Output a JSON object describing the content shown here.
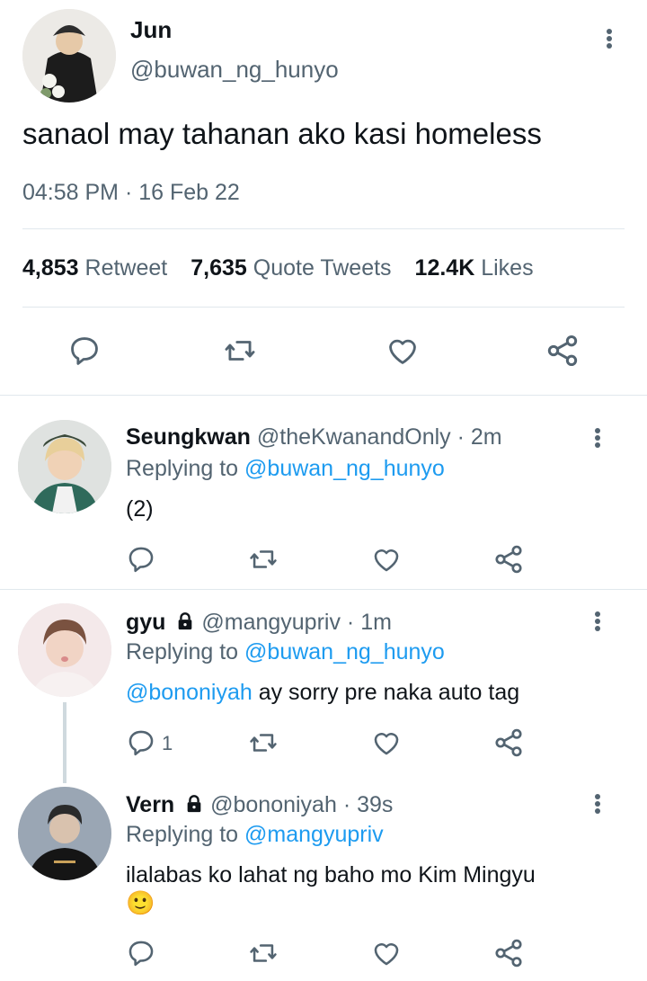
{
  "main_tweet": {
    "name": "Jun",
    "handle": "@buwan_ng_hunyo",
    "text": "sanaol may tahanan ako kasi homeless",
    "timestamp": "04:58 PM · 16 Feb 22",
    "stats": {
      "retweet_count": "4,853",
      "retweet_label": "Retweet",
      "quote_count": "7,635",
      "quote_label": "Quote Tweets",
      "likes_count": "12.4K",
      "likes_label": "Likes"
    }
  },
  "replies": [
    {
      "name": "Seungkwan",
      "handle": "@theKwanandOnly",
      "time": "· 2m",
      "replying_prefix": "Replying to",
      "replying_to": "@buwan_ng_hunyo",
      "text": "(2)",
      "reply_count": ""
    },
    {
      "name": "gyu",
      "locked": true,
      "handle": "@mangyupriv",
      "time": "· 1m",
      "replying_prefix": "Replying to",
      "replying_to": "@buwan_ng_hunyo",
      "mention": "@bononiyah",
      "text": " ay sorry pre naka auto tag",
      "reply_count": "1"
    },
    {
      "name": "Vern",
      "locked": true,
      "handle": "@bononiyah",
      "time": "· 39s",
      "replying_prefix": "Replying to",
      "replying_to": "@mangyupriv",
      "text": "ilalabas ko lahat ng baho mo Kim Mingyu",
      "emoji": "🙂",
      "reply_count": ""
    }
  ],
  "colors": {
    "link": "#1d9bf0",
    "secondary_text": "#536471",
    "divider": "#e1e8ed"
  }
}
